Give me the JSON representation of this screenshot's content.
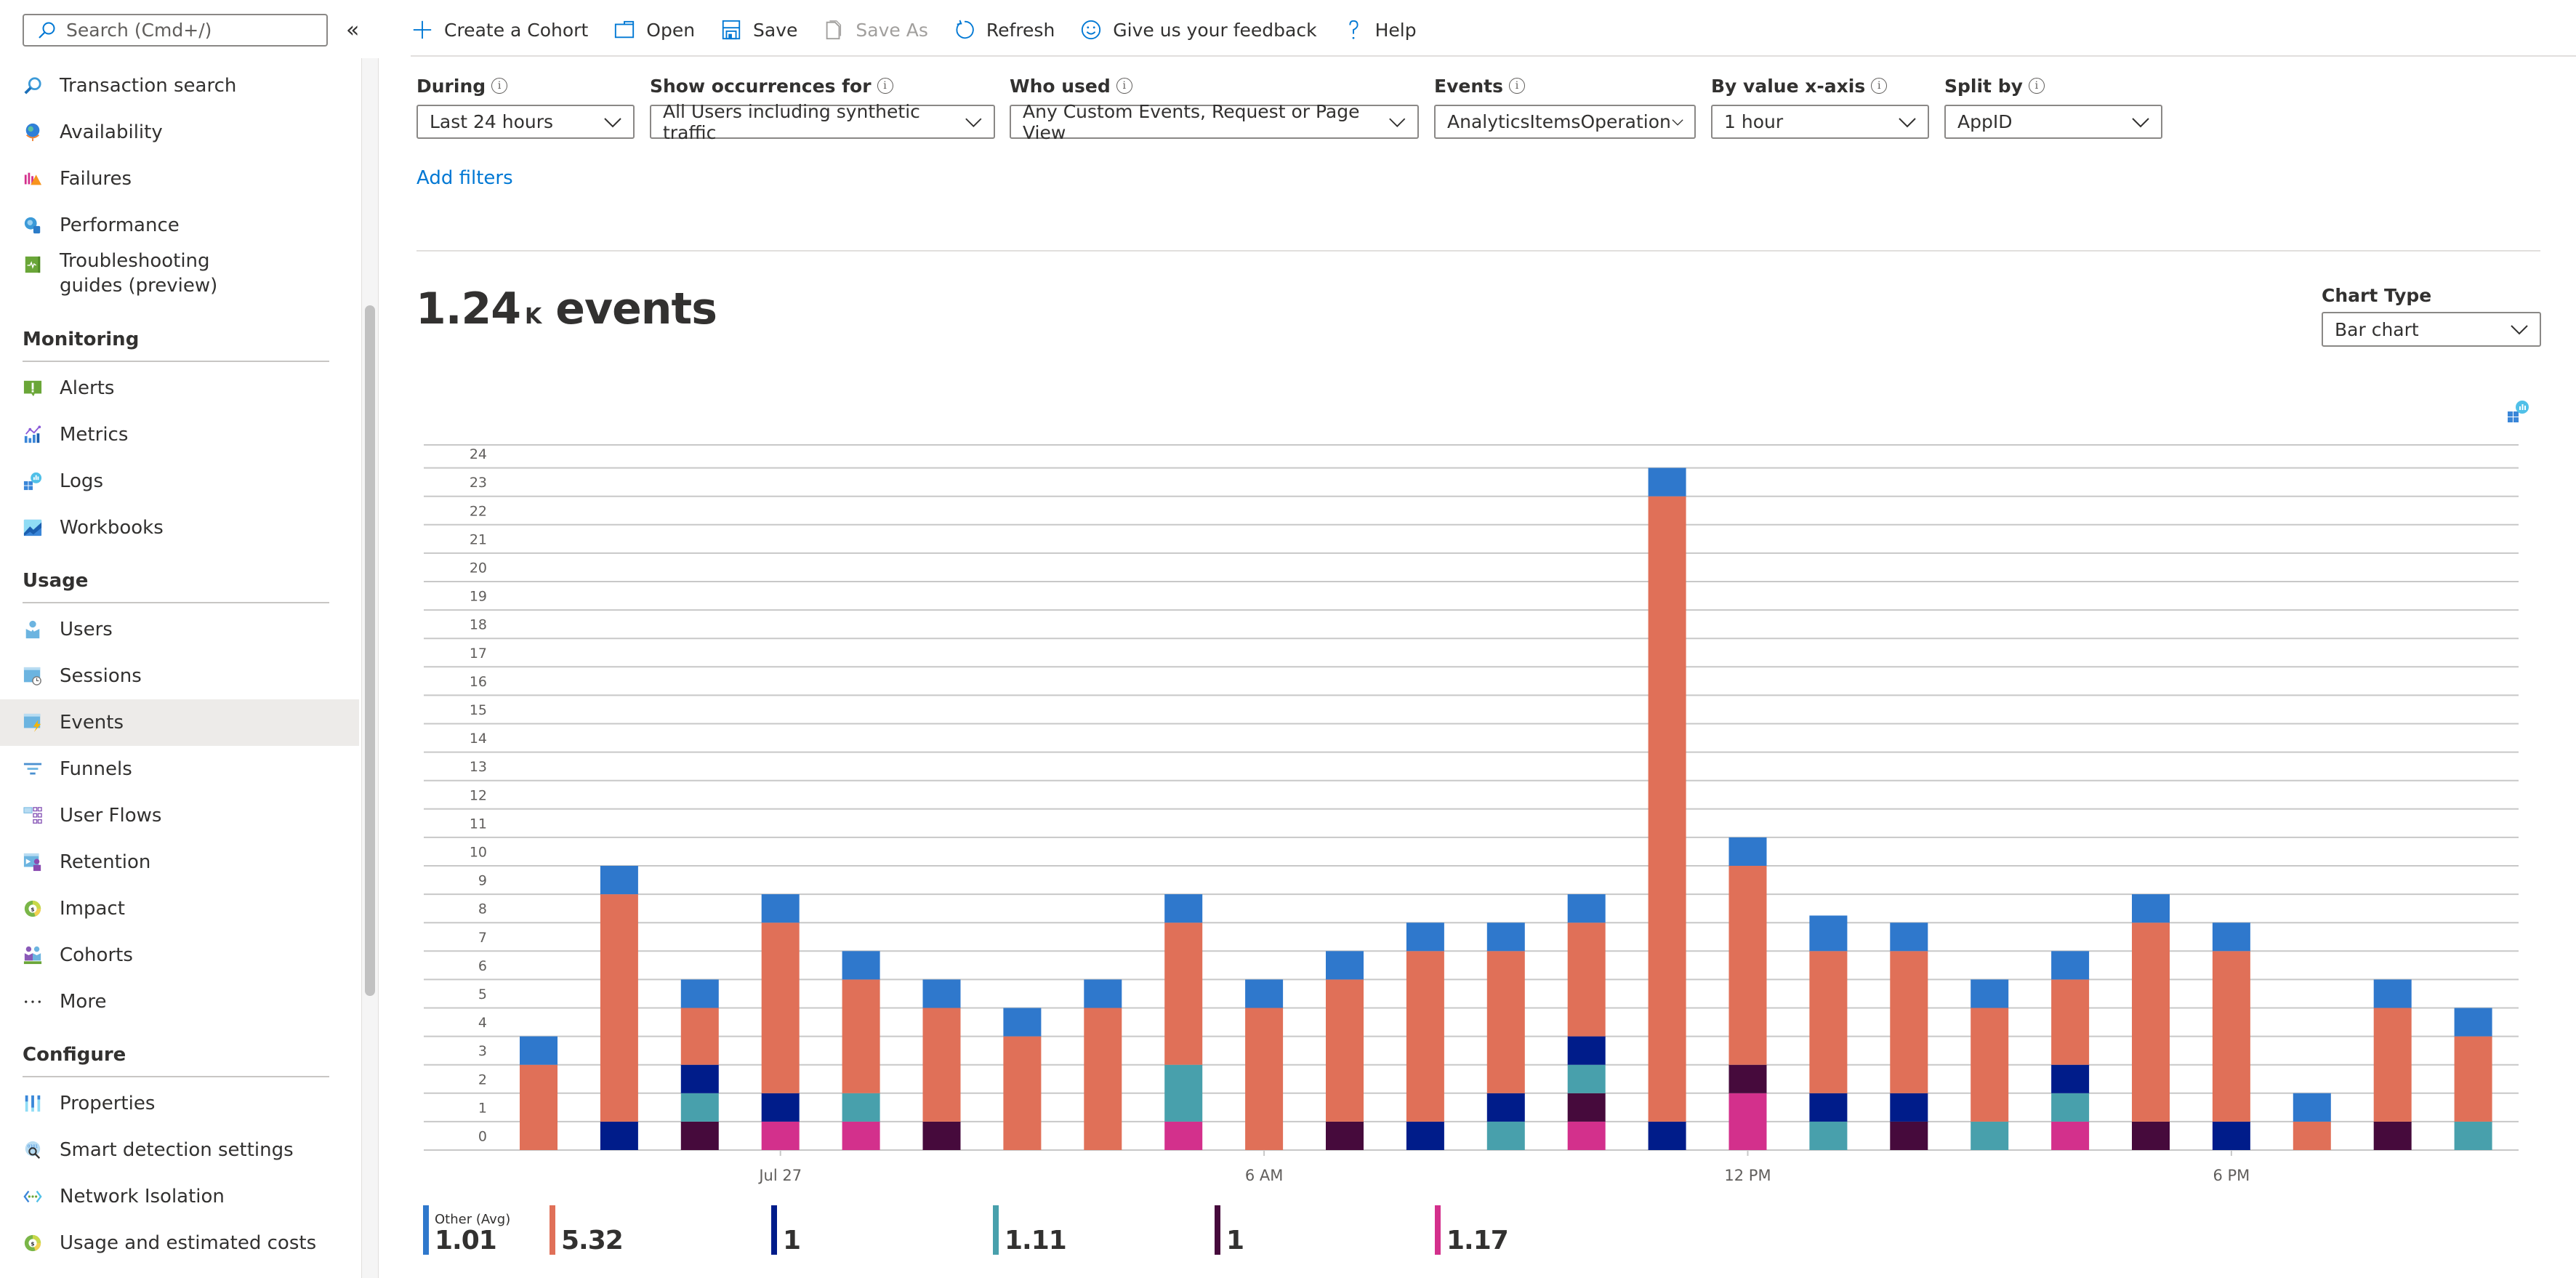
{
  "sidebar": {
    "search_placeholder": "Search (Cmd+/)",
    "collapse_icon": "double-chevron-left-icon",
    "top_items": [
      {
        "label": "Transaction search",
        "icon": "search-icon"
      },
      {
        "label": "Availability",
        "icon": "globe-icon"
      },
      {
        "label": "Failures",
        "icon": "failures-icon"
      },
      {
        "label": "Performance",
        "icon": "performance-icon"
      },
      {
        "label": "Troubleshooting guides (preview)",
        "icon": "guide-book-icon"
      }
    ],
    "sections": [
      {
        "title": "Monitoring",
        "items": [
          {
            "label": "Alerts",
            "icon": "alert-icon"
          },
          {
            "label": "Metrics",
            "icon": "metrics-icon"
          },
          {
            "label": "Logs",
            "icon": "logs-icon"
          },
          {
            "label": "Workbooks",
            "icon": "workbook-icon"
          }
        ]
      },
      {
        "title": "Usage",
        "items": [
          {
            "label": "Users",
            "icon": "user-icon"
          },
          {
            "label": "Sessions",
            "icon": "sessions-icon"
          },
          {
            "label": "Events",
            "icon": "events-icon",
            "selected": true
          },
          {
            "label": "Funnels",
            "icon": "funnel-icon"
          },
          {
            "label": "User Flows",
            "icon": "user-flows-icon"
          },
          {
            "label": "Retention",
            "icon": "retention-icon"
          },
          {
            "label": "Impact",
            "icon": "impact-icon"
          },
          {
            "label": "Cohorts",
            "icon": "cohorts-icon"
          },
          {
            "label": "More",
            "icon": "more-icon"
          }
        ]
      },
      {
        "title": "Configure",
        "items": [
          {
            "label": "Properties",
            "icon": "properties-icon"
          },
          {
            "label": "Smart detection settings",
            "icon": "smart-detection-icon"
          },
          {
            "label": "Network Isolation",
            "icon": "network-icon"
          },
          {
            "label": "Usage and estimated costs",
            "icon": "costs-icon"
          }
        ]
      }
    ]
  },
  "toolbar": {
    "create_cohort": "Create a Cohort",
    "open": "Open",
    "save": "Save",
    "save_as": "Save As",
    "refresh": "Refresh",
    "feedback": "Give us your feedback",
    "help": "Help"
  },
  "filters": {
    "during": {
      "label": "During",
      "value": "Last 24 hours"
    },
    "show_occurrences": {
      "label": "Show occurrences for",
      "value": "All Users including synthetic traffic"
    },
    "who_used": {
      "label": "Who used",
      "value": "Any Custom Events, Request or Page View"
    },
    "events": {
      "label": "Events",
      "value": "AnalyticsItemsOperation"
    },
    "by_value": {
      "label": "By value x-axis",
      "value": "1 hour"
    },
    "split_by": {
      "label": "Split by",
      "value": "AppID"
    },
    "add_filters": "Add filters",
    "info_glyph": "i"
  },
  "summary": {
    "value": "1.24",
    "suffix": "K",
    "unit": "events"
  },
  "chart_type": {
    "label": "Chart Type",
    "value": "Bar chart"
  },
  "colors": {
    "accent": "#0078d4",
    "other": "#2f78cc",
    "orange": "#e07058",
    "navy": "#001c8a",
    "teal": "#48a0ac",
    "purple": "#460a3c",
    "pink": "#d3308c"
  },
  "chart_data": {
    "type": "bar",
    "stacked": true,
    "title": "",
    "xlabel": "",
    "ylabel": "",
    "ylim": [
      0,
      25
    ],
    "yticks": [
      0,
      1,
      2,
      3,
      4,
      5,
      6,
      7,
      8,
      9,
      10,
      11,
      12,
      13,
      14,
      15,
      16,
      17,
      18,
      19,
      20,
      21,
      22,
      23,
      24
    ],
    "grid": true,
    "x_tick_labels": [
      {
        "index": 3,
        "label": "Jul 27"
      },
      {
        "index": 9,
        "label": "6 AM"
      },
      {
        "index": 15,
        "label": "12 PM"
      },
      {
        "index": 21,
        "label": "6 PM"
      }
    ],
    "categories": [
      "h1",
      "h2",
      "h3",
      "h4",
      "h5",
      "h6",
      "h7",
      "h8",
      "h9",
      "h10",
      "h11",
      "h12",
      "h13",
      "h14",
      "h15",
      "h16",
      "h17",
      "h18",
      "h19",
      "h20",
      "h21",
      "h22",
      "h23",
      "h24",
      "h25"
    ],
    "series": [
      {
        "name": "",
        "color": "#d3308c",
        "legend_value": "1.17",
        "values": [
          0,
          0,
          0,
          1,
          1,
          0,
          0,
          0,
          1,
          0,
          0,
          0,
          0,
          1,
          0,
          2,
          0,
          0,
          0,
          1,
          0,
          0,
          0,
          0,
          0
        ]
      },
      {
        "name": "",
        "color": "#460a3c",
        "legend_value": "1",
        "values": [
          0,
          0,
          1,
          0,
          0,
          1,
          0,
          0,
          0,
          0,
          1,
          0,
          0,
          1,
          0,
          1,
          0,
          1,
          0,
          0,
          1,
          0,
          0,
          1,
          0
        ]
      },
      {
        "name": "",
        "color": "#48a0ac",
        "legend_value": "1.11",
        "values": [
          0,
          0,
          1,
          0,
          1,
          0,
          0,
          0,
          2,
          0,
          0,
          0,
          1,
          1,
          0,
          0,
          1,
          0,
          1,
          1,
          0,
          0,
          0,
          0,
          1
        ]
      },
      {
        "name": "",
        "color": "#001c8a",
        "legend_value": "1",
        "values": [
          0,
          1,
          1,
          1,
          0,
          0,
          0,
          0,
          0,
          0,
          0,
          1,
          1,
          1,
          1,
          0,
          1,
          1,
          0,
          1,
          0,
          1,
          0,
          0,
          0
        ]
      },
      {
        "name": "",
        "color": "#e07058",
        "legend_value": "5.32",
        "values": [
          3,
          8,
          2,
          6,
          4,
          4,
          4,
          5,
          5,
          5,
          5,
          6,
          5,
          4,
          22,
          7,
          5,
          5,
          4,
          3,
          7,
          6,
          1,
          4,
          3
        ]
      },
      {
        "name": "Other (Avg)",
        "color": "#2f78cc",
        "legend_value": "1.01",
        "values": [
          1,
          1,
          1,
          1,
          1,
          1,
          1,
          1,
          1,
          1,
          1,
          1,
          1,
          1,
          1,
          1,
          1.25,
          1,
          1,
          1,
          1,
          1,
          1,
          1,
          1
        ]
      }
    ],
    "legend": {
      "placement": "bottom-left",
      "order": [
        "Other (Avg)",
        "",
        "",
        "",
        "",
        ""
      ]
    }
  }
}
